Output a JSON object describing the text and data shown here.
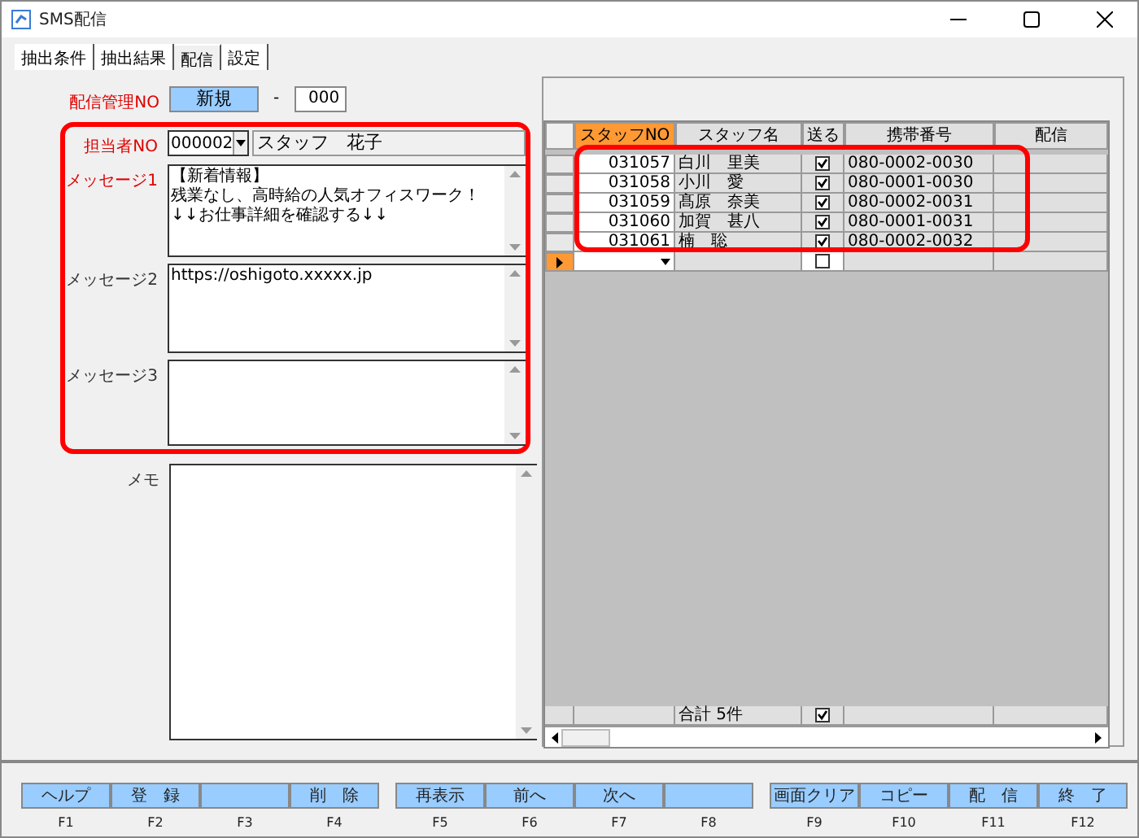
{
  "window": {
    "title": "SMS配信"
  },
  "tabs": [
    {
      "label": "抽出条件",
      "selected": false
    },
    {
      "label": "抽出結果",
      "selected": false
    },
    {
      "label": "配信",
      "selected": true
    },
    {
      "label": "設定",
      "selected": false
    }
  ],
  "form": {
    "management_no": {
      "label": "配信管理NO",
      "value": "新規",
      "separator": "-",
      "suffix": "000"
    },
    "staff_no": {
      "label": "担当者NO",
      "value": "000002",
      "name": "スタッフ　花子"
    },
    "messages": [
      {
        "label": "メッセージ1",
        "lines": [
          "【新着情報】",
          "残業なし、高時給の人気オフィスワーク！",
          "↓↓お仕事詳細を確認する↓↓"
        ],
        "required": true
      },
      {
        "label": "メッセージ2",
        "lines": [
          "https://oshigoto.xxxxx.jp"
        ],
        "required": false
      },
      {
        "label": "メッセージ3",
        "required": false
      }
    ],
    "memo": {
      "label": "メモ"
    }
  },
  "grid": {
    "columns": [
      {
        "label": "スタッフNO",
        "selected": true
      },
      {
        "label": "スタッフ名",
        "selected": false
      },
      {
        "label": "送る",
        "selected": false
      },
      {
        "label": "携帯番号",
        "selected": false
      },
      {
        "label": "配信",
        "selected": false
      }
    ],
    "rows": [
      {
        "staff_no": "031057",
        "name": "白川　里美",
        "send": true,
        "phone": "080-0002-0030"
      },
      {
        "staff_no": "031058",
        "name": "小川　愛",
        "send": true,
        "phone": "080-0001-0030"
      },
      {
        "staff_no": "031059",
        "name": "髙原　奈美",
        "send": true,
        "phone": "080-0002-0031"
      },
      {
        "staff_no": "031060",
        "name": "加賀　甚八",
        "send": true,
        "phone": "080-0001-0031"
      },
      {
        "staff_no": "031061",
        "name": "楠　聡",
        "send": true,
        "phone": "080-0002-0032"
      }
    ],
    "new_row": {
      "send": false
    },
    "total": {
      "label": "合計 5件",
      "send": true
    }
  },
  "function_keys": [
    {
      "label": "ヘルプ",
      "key": "F1"
    },
    {
      "label": "登　録",
      "key": "F2"
    },
    {
      "key": "F3"
    },
    {
      "label": "削　除",
      "key": "F4"
    },
    {
      "label": "再表示",
      "key": "F5"
    },
    {
      "label": "前へ",
      "key": "F6"
    },
    {
      "label": "次へ",
      "key": "F7"
    },
    {
      "key": "F8"
    },
    {
      "label": "画面クリア",
      "key": "F9"
    },
    {
      "label": "コピー",
      "key": "F10"
    },
    {
      "label": "配　信",
      "key": "F11"
    },
    {
      "label": "終　了",
      "key": "F12"
    }
  ]
}
